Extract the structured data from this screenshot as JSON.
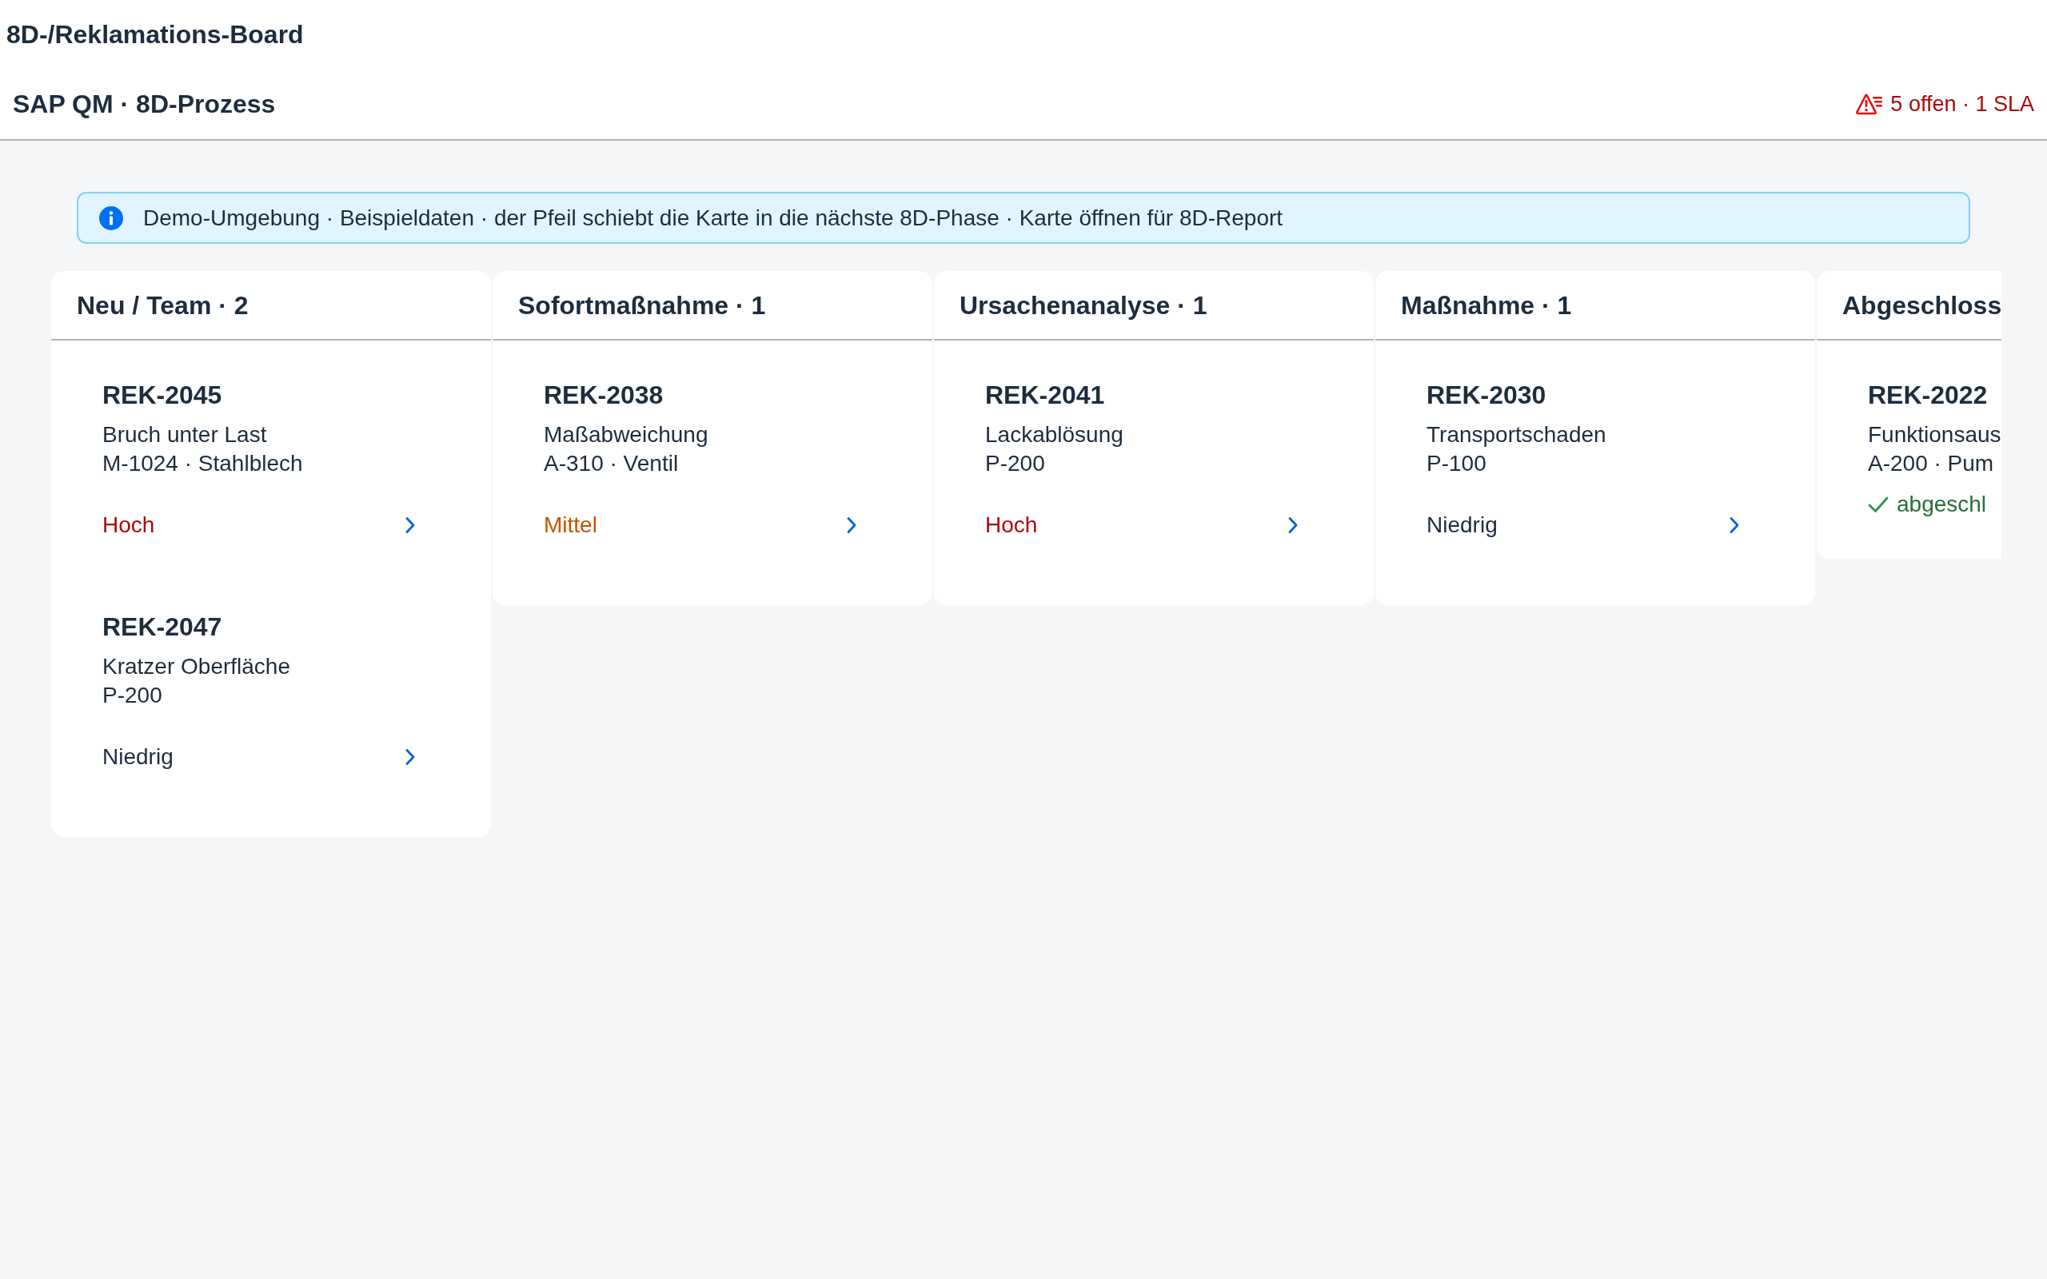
{
  "app": {
    "title": "8D-/Reklamations-Board"
  },
  "subheader": {
    "title": "SAP QM · 8D-Prozess",
    "alert": "5 offen · 1 SLA"
  },
  "info_strip": {
    "text": "Demo-Umgebung · Beispieldaten · der Pfeil schiebt die Karte in die nächste 8D-Phase · Karte öffnen für 8D-Report"
  },
  "columns": [
    {
      "title": "Neu / Team · 2",
      "cards": [
        {
          "kind": "open",
          "id": "REK-2045",
          "defect": "Bruch unter Last",
          "part": "M-1024 · Stahlblech",
          "priority": "Hoch",
          "color": "#aa0808"
        },
        {
          "kind": "open",
          "id": "REK-2047",
          "defect": "Kratzer Oberfläche",
          "part": "P-200",
          "priority": "Niedrig",
          "color": "#1d2d3e"
        }
      ]
    },
    {
      "title": "Sofortmaßnahme · 1",
      "cards": [
        {
          "kind": "open",
          "id": "REK-2038",
          "defect": "Maßabweichung",
          "part": "A-310 · Ventil",
          "priority": "Mittel",
          "color": "#c35500"
        }
      ]
    },
    {
      "title": "Ursachenanalyse · 1",
      "cards": [
        {
          "kind": "open",
          "id": "REK-2041",
          "defect": "Lackablösung",
          "part": "P-200",
          "priority": "Hoch",
          "color": "#aa0808"
        }
      ]
    },
    {
      "title": "Maßnahme · 1",
      "cards": [
        {
          "kind": "open",
          "id": "REK-2030",
          "defect": "Transportschaden",
          "part": "P-100",
          "priority": "Niedrig",
          "color": "#1d2d3e"
        }
      ]
    },
    {
      "title": "Abgeschloss",
      "cards": [
        {
          "kind": "closed",
          "id": "REK-2022",
          "defect": "Funktionsaus",
          "part": "A-200 · Pum",
          "status": "abgeschl"
        }
      ]
    }
  ]
}
